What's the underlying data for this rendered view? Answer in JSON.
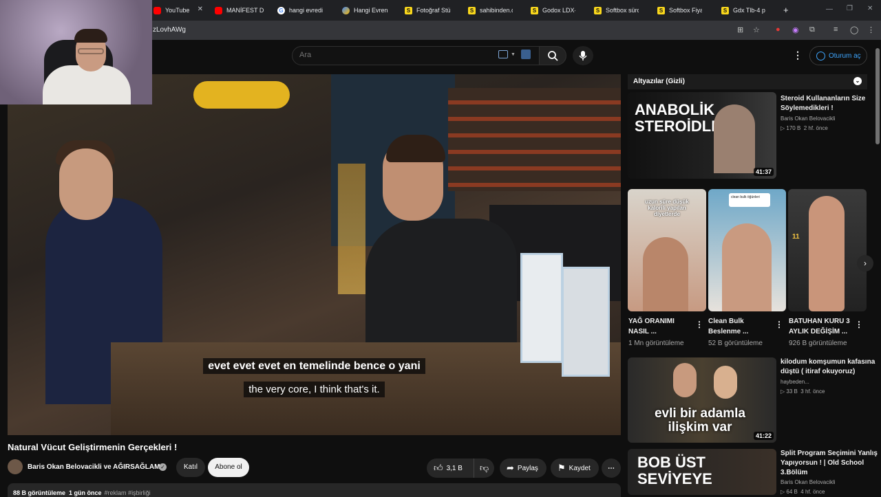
{
  "browser": {
    "tabs": [
      {
        "label": "YouTube",
        "fav": "yt"
      },
      {
        "label": "MANİFEST D",
        "fav": "yt"
      },
      {
        "label": "hangi evredi",
        "fav": "g"
      },
      {
        "label": "Hangi Evren",
        "fav": "p"
      },
      {
        "label": "Fotoğraf Stü",
        "fav": "s"
      },
      {
        "label": "sahibinden.c",
        "fav": "s"
      },
      {
        "label": "Godox LDX-",
        "fav": "s"
      },
      {
        "label": "Softbox sürc",
        "fav": "s"
      },
      {
        "label": "Softbox Fiya",
        "fav": "s"
      },
      {
        "label": "Gdx Tlb-4 p",
        "fav": "s"
      }
    ],
    "new_tab_label": "+",
    "url": "zLovhAWg"
  },
  "header": {
    "search_placeholder": "Ara",
    "menu_label": "⋮",
    "signin_label": "Oturum aç"
  },
  "player": {
    "caption_tr": "evet evet evet en temelinde bence o yani",
    "caption_en": "the very core, I think that's it."
  },
  "video": {
    "title": "Natural Vücut Geliştirmenin Gerçekleri !",
    "channel": "Baris Okan Belovacikli ve AĞIRSAĞLAM",
    "join_label": "Katıl",
    "subscribe_label": "Abone ol",
    "likes": "3,1 B",
    "share_label": "Paylaş",
    "save_label": "Kaydet",
    "views": "88 B görüntüleme",
    "age": "1 gün önce",
    "tags": "#reklam #işbirliği"
  },
  "sidebar": {
    "chapters_label": "Altyazılar (Gizli)",
    "videos": [
      {
        "title_line1": "Steroid Kullananların Size",
        "title_line2": "Söylemedikleri !",
        "channel": "Baris Okan Belovacikli",
        "views": "▷ 170 B",
        "age": "2 hf. önce",
        "duration": "41:37",
        "thumb_text": "ANABOLİK STEROİDLER"
      },
      {
        "title_line1": "kilodum komşumun kafasına",
        "title_line2": "düştü ( itiraf okuyoruz)",
        "channel": "haybeden...",
        "views": "▷ 33 B",
        "age": "3 hf. önce",
        "duration": "41:22",
        "thumb_text": "evli bir adamla ilişkim var"
      },
      {
        "title_line1": "Split Program Seçimini Yanlış",
        "title_line2": "Yapıyorsun ! | Old School",
        "title_line3": "3.Bölüm",
        "channel": "Baris Okan Belovacikli",
        "views": "▷ 64 B",
        "age": "4 hf. önce",
        "thumb_text": "BOB ÜST SEVİYEYE"
      }
    ],
    "shorts": [
      {
        "title_line1": "YAĞ ORANIMI",
        "title_line2": "NASIL ...",
        "views": "1 Mn görüntüleme",
        "overlay": "uzun süre düşük kalorili yapılan diyetlerde"
      },
      {
        "title_line1": "Clean Bulk",
        "title_line2": "Beslenme ...",
        "views": "52 B görüntüleme",
        "overlay": "clean bulk öğünleri"
      },
      {
        "title_line1": "BATUHAN KURU 3",
        "title_line2": "AYLIK DEĞİŞİM ...",
        "views": "926 B görüntüleme",
        "overlay": "11"
      }
    ]
  }
}
